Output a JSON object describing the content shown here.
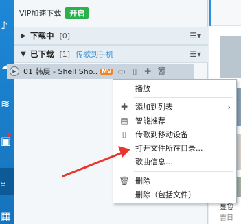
{
  "vip": {
    "label": "VIP加速下载",
    "button": "开启"
  },
  "groups": {
    "downloading": {
      "title": "下载中",
      "count": "[0]"
    },
    "downloaded": {
      "title": "已下载",
      "count": "[1]",
      "extra": "传歌到手机"
    }
  },
  "song": {
    "text": "01 韩庚 - Shell Sho...",
    "badge": "MV"
  },
  "context_menu": {
    "play": "播放",
    "add_to_list": "添加到列表",
    "smart_recommend": "智能推荐",
    "send_to_device": "传歌到移动设备",
    "open_folder": "打开文件所在目录...",
    "song_info": "歌曲信息...",
    "delete": "删除",
    "delete_with_file": "删除（包括文件）"
  },
  "right_panel": {
    "line1": "显我",
    "line2": "吉日"
  },
  "colors": {
    "accent": "#2f8fd8",
    "vip_green": "#2bb04b",
    "arrow_red": "#e8352e"
  }
}
